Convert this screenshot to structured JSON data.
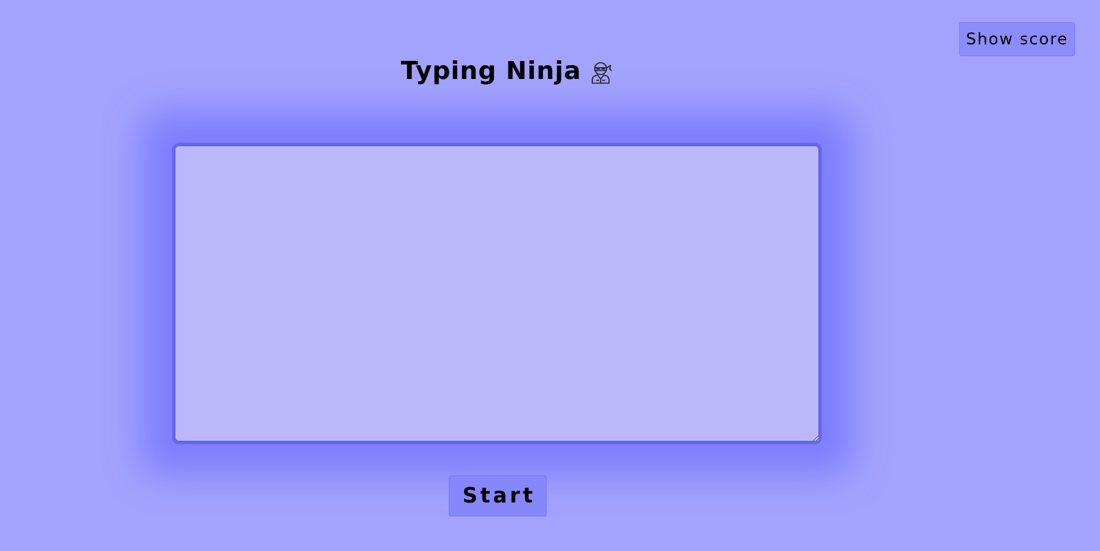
{
  "header": {
    "title": "Typing Ninja",
    "title_icon": "ninja-icon",
    "show_score_label": "Show score"
  },
  "editor": {
    "value": "",
    "placeholder": ""
  },
  "controls": {
    "start_label": "Start"
  },
  "colors": {
    "background": "#a3a3fd",
    "textarea_fill": "#bab8f9",
    "textarea_border": "#6666f0",
    "button_fill": "#8787fc"
  }
}
